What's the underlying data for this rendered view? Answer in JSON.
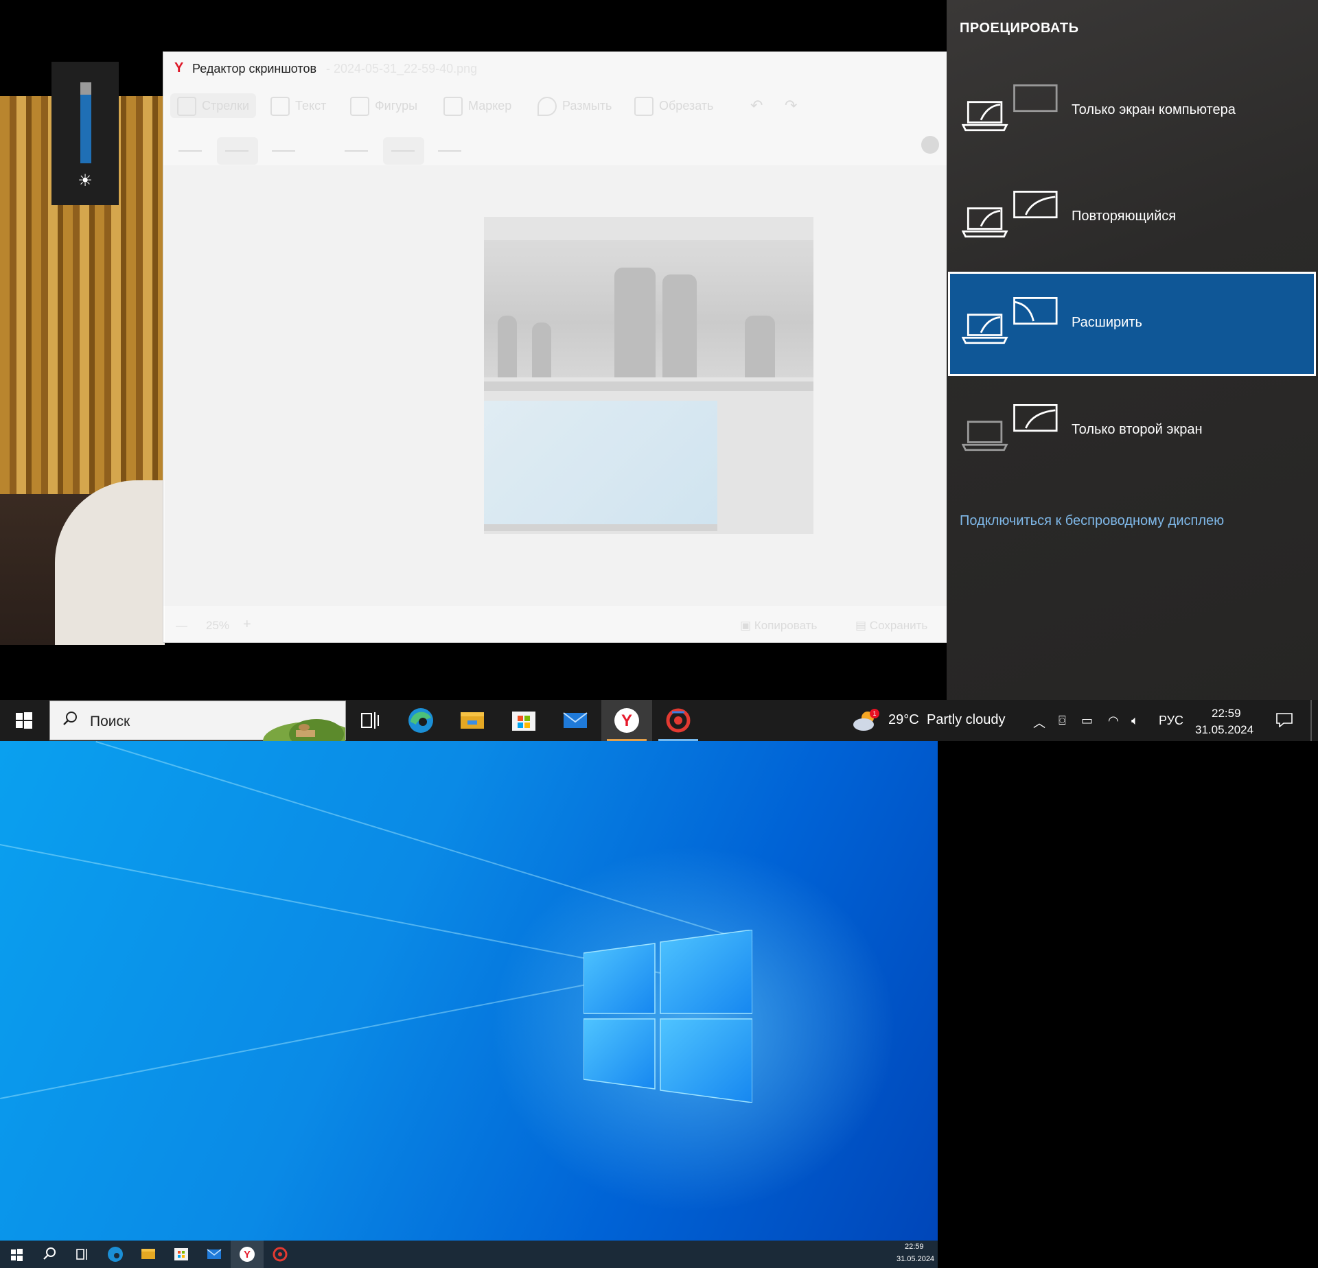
{
  "editor": {
    "title": "Редактор скриншотов",
    "filename": "- 2024-05-31_22-59-40.png",
    "tools": [
      {
        "label": "Стрелки",
        "icon": "arrow-icon"
      },
      {
        "label": "Текст",
        "icon": "text-icon"
      },
      {
        "label": "Фигуры",
        "icon": "shapes-icon"
      },
      {
        "label": "Маркер",
        "icon": "marker-icon"
      },
      {
        "label": "Размыть",
        "icon": "blur-icon"
      },
      {
        "label": "Обрезать",
        "icon": "crop-icon"
      }
    ],
    "zoom": "25%",
    "copy_label": "Копировать",
    "save_label": "Сохранить"
  },
  "brightness": {
    "level": 0.85
  },
  "project": {
    "title": "ПРОЕЦИРОВАТЬ",
    "options": [
      {
        "label": "Только экран компьютера",
        "selected": false
      },
      {
        "label": "Повторяющийся",
        "selected": false
      },
      {
        "label": "Расширить",
        "selected": true
      },
      {
        "label": "Только второй экран",
        "selected": false
      }
    ],
    "wireless_link": "Подключиться к беспроводному дисплею",
    "selected_color": "#0f5797",
    "link_color": "#7fb8e8"
  },
  "taskbar": {
    "search_placeholder": "Поиск",
    "apps": [
      "task-view-icon",
      "edge-icon",
      "explorer-icon",
      "store-icon",
      "mail-icon",
      "yandex-icon",
      "screenshot-app-icon"
    ],
    "weather": {
      "temp": "29°C",
      "condition": "Partly cloudy",
      "badge": "1"
    },
    "language": "РУС",
    "time": "22:59",
    "date": "31.05.2024"
  },
  "second_display": {
    "time": "22:59",
    "date": "31.05.2024"
  }
}
